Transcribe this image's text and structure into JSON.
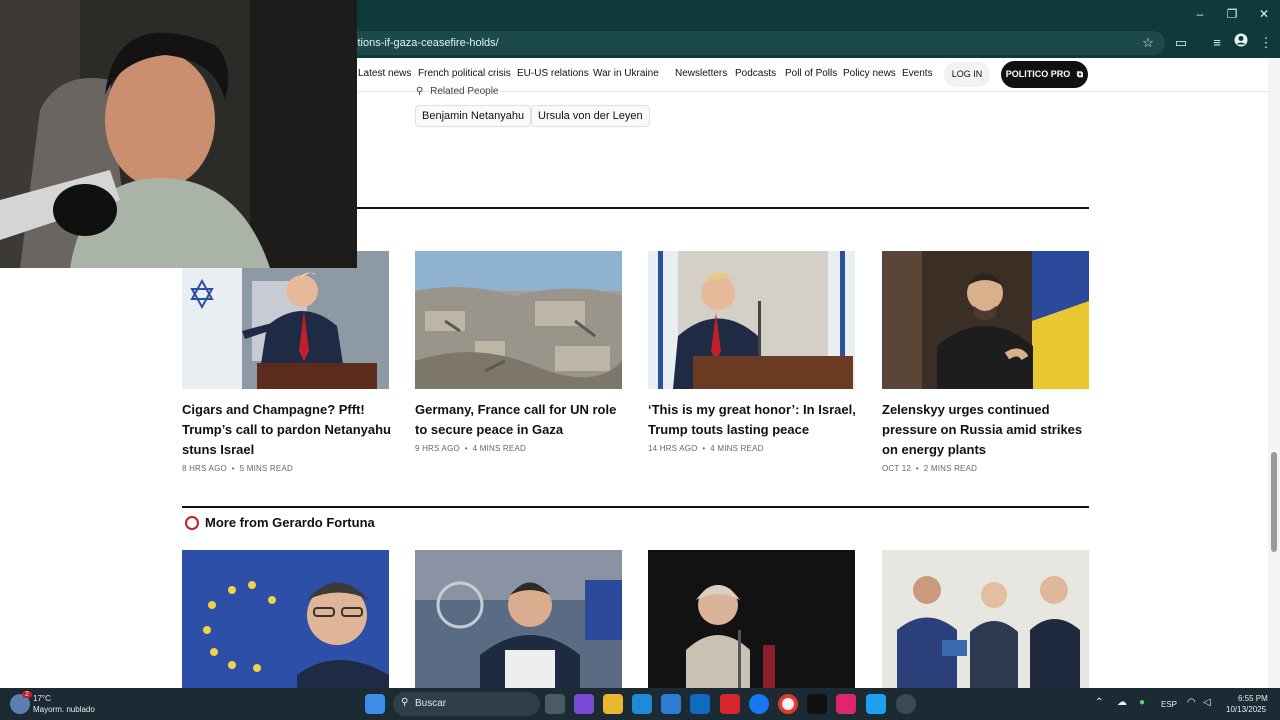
{
  "browser": {
    "url": "ctions-if-gaza-ceasefire-holds/",
    "window_controls": [
      "–",
      "❐",
      "✕"
    ],
    "toolbar_icons": [
      "star-icon",
      "cast-icon",
      "tab-search-icon",
      "profile-icon",
      "menu-icon"
    ]
  },
  "nav": {
    "items": [
      "Latest news",
      "French political crisis",
      "EU-US relations",
      "War in Ukraine",
      "Newsletters",
      "Podcasts",
      "Poll of Polls",
      "Policy news",
      "Events"
    ],
    "login_label": "LOG IN",
    "pro_label": "POLITICO PRO",
    "pro_icon": "⧉"
  },
  "related": {
    "heading": "Related People",
    "people": [
      "Benjamin Netanyahu",
      "Ursula von der Leyen"
    ]
  },
  "articles": [
    {
      "title": "Cigars and Champagne? Pfft! Trump’s call to pardon Netanyahu stuns Israel",
      "time": "8 HRS AGO",
      "read": "5 MINS READ"
    },
    {
      "title": "Germany, France call for UN role to secure peace in Gaza",
      "time": "9 HRS AGO",
      "read": "4 MINS READ"
    },
    {
      "title": "‘This is my great honor’: In Israel, Trump touts lasting peace",
      "time": "14 HRS AGO",
      "read": "4 MINS READ"
    },
    {
      "title": "Zelenskyy urges continued pressure on Russia amid strikes on energy plants",
      "time": "OCT 12",
      "read": "2 MINS READ"
    }
  ],
  "more_from": {
    "heading": "More from Gerardo Fortuna"
  },
  "taskbar": {
    "temp": "17°C",
    "weather": "Mayorm. nublado",
    "search_placeholder": "Buscar",
    "lang": "ESP",
    "time": "6:55 PM",
    "date": "10/13/2025",
    "weather_badge": "2"
  },
  "colors": {
    "browser_frame": "#0f3a3b",
    "accent_red": "#c0202a",
    "taskbar": "#1b2a33"
  }
}
